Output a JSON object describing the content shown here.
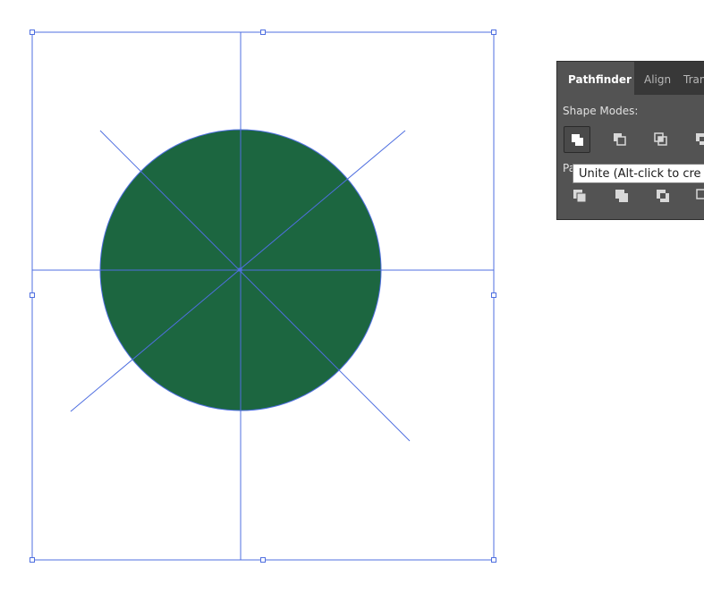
{
  "canvas": {
    "circle_fill": "#1c6640",
    "guide_color": "#4f6fe0",
    "selection_color": "#4f6fe0"
  },
  "pathfinder_panel": {
    "tabs": [
      {
        "label": "Pathfinder",
        "active": true
      },
      {
        "label": "Align",
        "active": false
      },
      {
        "label": "Tran",
        "active": false
      }
    ],
    "shape_modes_label": "Shape Modes:",
    "pathfinders_label": "Pa",
    "shape_mode_buttons": [
      {
        "name": "unite",
        "icon": "unite-icon",
        "selected": true
      },
      {
        "name": "minus-front",
        "icon": "minus-front-icon",
        "selected": false
      },
      {
        "name": "intersect",
        "icon": "intersect-icon",
        "selected": false
      },
      {
        "name": "exclude",
        "icon": "exclude-icon",
        "selected": false
      }
    ],
    "pathfinder_buttons": [
      {
        "name": "divide",
        "icon": "divide-icon"
      },
      {
        "name": "trim",
        "icon": "trim-icon"
      },
      {
        "name": "merge",
        "icon": "merge-icon"
      },
      {
        "name": "crop",
        "icon": "crop-icon"
      }
    ],
    "tooltip": "Unite (Alt-click to cre",
    "colors": {
      "panel_bg": "#535353",
      "tab_bar_bg": "#383838",
      "icon_light": "#d8d8d8"
    }
  }
}
